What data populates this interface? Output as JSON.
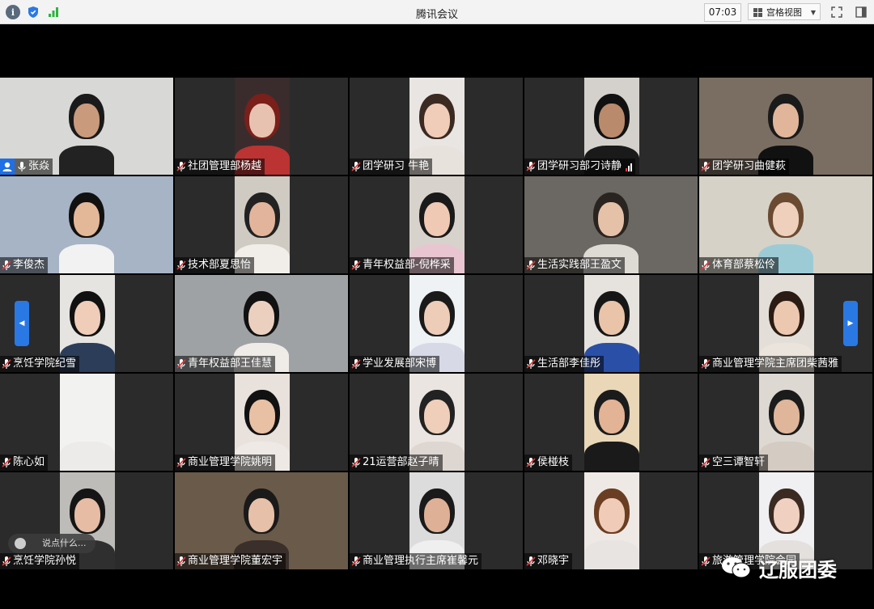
{
  "window": {
    "title": "腾讯会议",
    "time": "07:03",
    "view_mode": "宫格视图"
  },
  "participants": [
    {
      "name": "张焱",
      "host": true,
      "active": true
    },
    {
      "name": "社团管理部杨越"
    },
    {
      "name": "团学研习 牛艳"
    },
    {
      "name": "团学研习部刁诗静",
      "signal": true
    },
    {
      "name": "团学研习曲健萩"
    },
    {
      "name": "李俊杰"
    },
    {
      "name": "技术部夏思怡"
    },
    {
      "name": "青年权益部-倪桦采"
    },
    {
      "name": "生活实践部王盈文"
    },
    {
      "name": "体育部蔡松伶"
    },
    {
      "name": "烹饪学院纪雪"
    },
    {
      "name": "青年权益部王佳慧"
    },
    {
      "name": "学业发展部宋博"
    },
    {
      "name": "生活部李佳彤"
    },
    {
      "name": "商业管理学院主席团柴茜雅"
    },
    {
      "name": "陈心如"
    },
    {
      "name": "商业管理学院姚明"
    },
    {
      "name": "21运营部赵子晴"
    },
    {
      "name": "侯椪枝"
    },
    {
      "name": "空三谭智轩"
    },
    {
      "name": "烹饪学院孙悦"
    },
    {
      "name": "商业管理学院董宏宇"
    },
    {
      "name": "商业管理执行主席崔馨元"
    },
    {
      "name": "邓晓宇"
    },
    {
      "name": "旅游管理学院会园"
    }
  ],
  "chat_placeholder": "说点什么...",
  "watermark": "辽服团委",
  "colors": {
    "accent": "#1f6fe5",
    "active_border": "#4a9a6a"
  }
}
